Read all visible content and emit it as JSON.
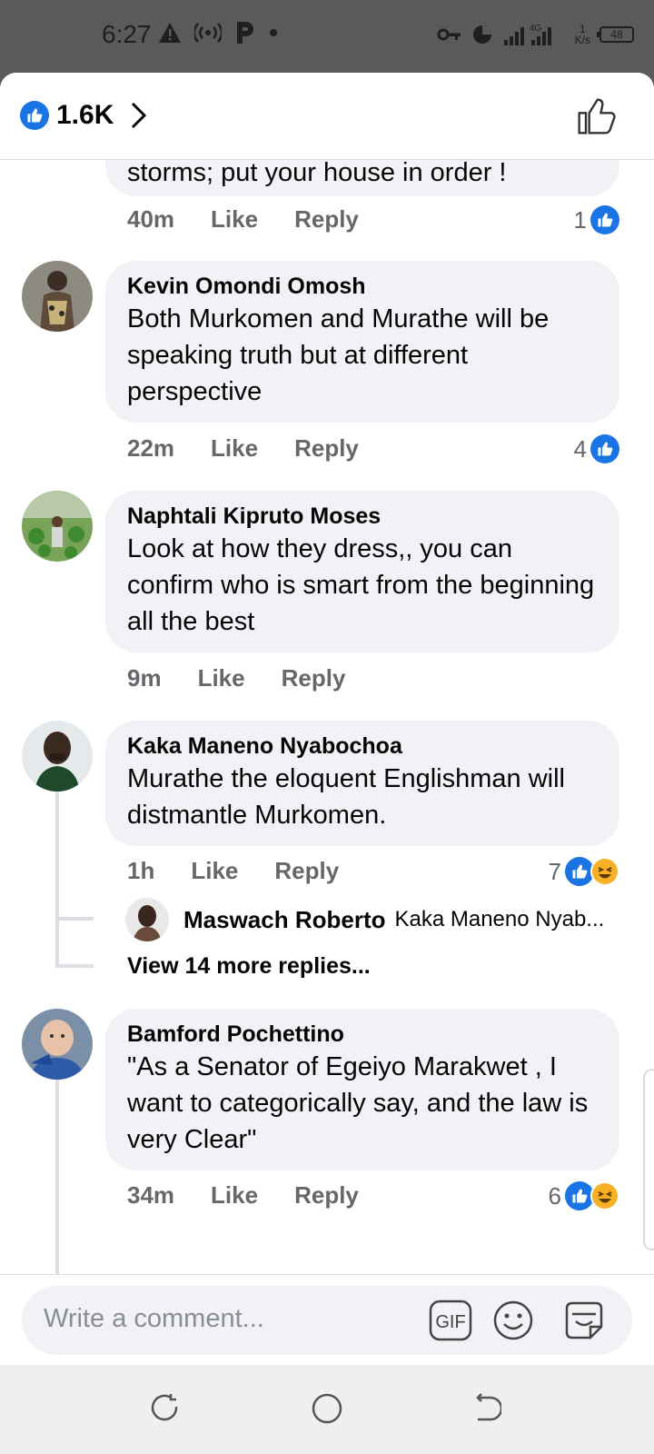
{
  "status_bar": {
    "time": "6:27",
    "network": "4G",
    "speed_value": "1",
    "speed_unit": "K/s",
    "battery": "48"
  },
  "header": {
    "reaction_count": "1.6K"
  },
  "comments": [
    {
      "text": "storms; put your house in order !",
      "time": "40m",
      "like_label": "Like",
      "reply_label": "Reply",
      "reactions": "1"
    },
    {
      "author": "Kevin Omondi Omosh",
      "text": "Both Murkomen and Murathe will be speaking truth but at different perspective",
      "time": "22m",
      "like_label": "Like",
      "reply_label": "Reply",
      "reactions": "4"
    },
    {
      "author": "Naphtali Kipruto Moses",
      "text": "Look at how they dress,, you can confirm who is smart from the beginning all the best",
      "time": "9m",
      "like_label": "Like",
      "reply_label": "Reply"
    },
    {
      "author": "Kaka Maneno Nyabochoa",
      "text": "Murathe the eloquent Englishman will distmantle Murkomen.",
      "time": "1h",
      "like_label": "Like",
      "reply_label": "Reply",
      "reactions": "7",
      "reply_preview": {
        "author": "Maswach Roberto",
        "text": "Kaka Maneno Nyab..."
      },
      "view_more": "View 14 more replies..."
    },
    {
      "author": "Bamford Pochettino",
      "text": "\"As a Senator of Egeiyo Marakwet , I want to categorically say, and the law is very Clear\"",
      "time": "34m",
      "like_label": "Like",
      "reply_label": "Reply",
      "reactions": "6"
    }
  ],
  "composer": {
    "placeholder": "Write a comment...",
    "gif_label": "GIF"
  },
  "colors": {
    "accent": "#1b74e4",
    "bubble": "#f0f2f5",
    "meta": "#65676b",
    "haha": "#f7b125"
  },
  "icons": [
    "warning-icon",
    "hotspot-icon",
    "parking-icon",
    "vpn-key-icon",
    "data-saver-icon",
    "signal-icon",
    "battery-icon",
    "like-icon",
    "haha-icon",
    "chevron-right-icon",
    "thumbs-up-outline-icon",
    "emoji-icon",
    "sticker-icon",
    "recent-apps-icon",
    "home-icon",
    "back-icon"
  ]
}
